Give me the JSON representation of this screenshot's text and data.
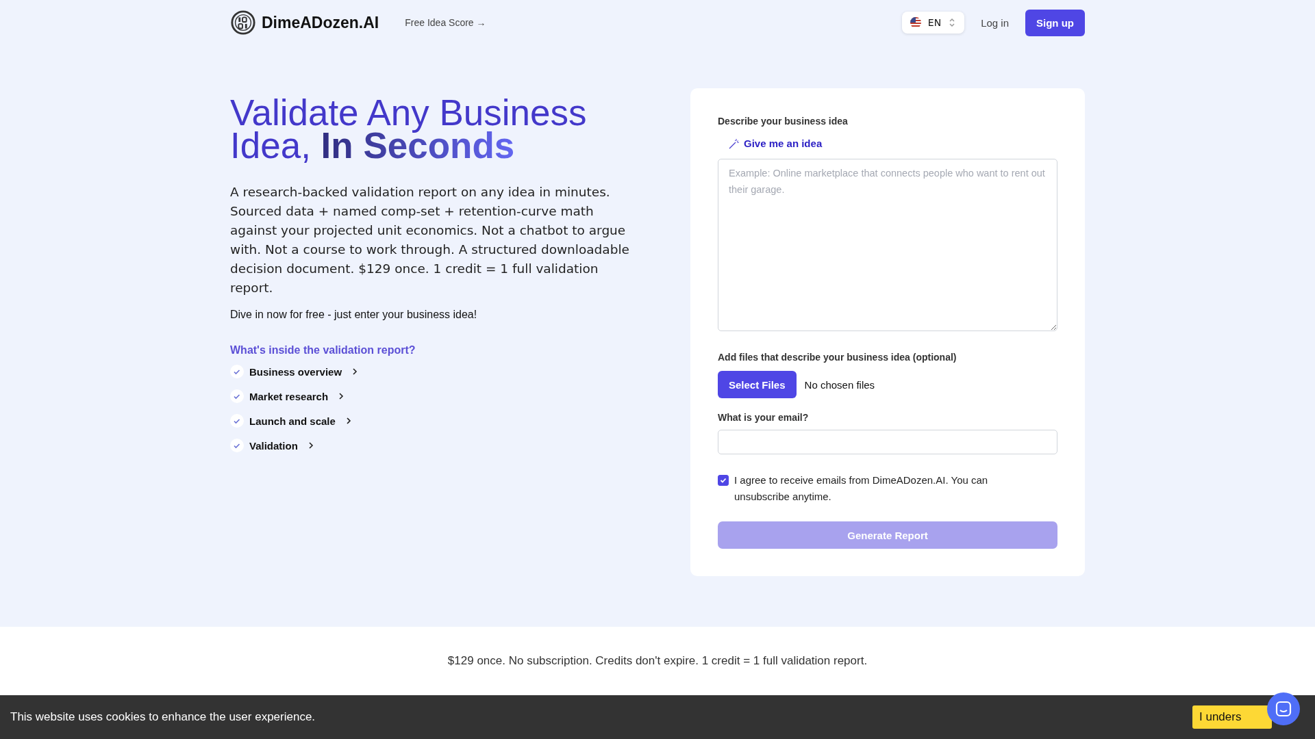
{
  "header": {
    "logo": "DimeADozen.AI",
    "nav_link": "Free Idea Score →",
    "language": "EN",
    "login": "Log in",
    "signup": "Sign up"
  },
  "hero": {
    "title_plain": "Validate Any Business Idea,",
    "title_bold": "In Seconds",
    "description": "A research-backed validation report on any idea in minutes. Sourced data + named comp-set + retention-curve math against your projected unit economics. Not a chatbot to argue with. Not a course to work through. A structured downloadable decision document. $129 once. 1 credit = 1 full validation report.",
    "subtitle": "Dive in now for free - just enter your business idea!",
    "report_heading": "What's inside the validation report?",
    "report_items": [
      {
        "label": "Business overview"
      },
      {
        "label": "Market research"
      },
      {
        "label": "Launch and scale"
      },
      {
        "label": "Validation"
      }
    ]
  },
  "form": {
    "idea_label": "Describe your business idea",
    "idea_link": "Give me an idea",
    "idea_placeholder": "Example: Online marketplace that connects people who want to rent out their garage.",
    "files_label": "Add files that describe your business idea (optional)",
    "files_button": "Select Files",
    "files_status": "No chosen files",
    "email_label": "What is your email?",
    "consent": "I agree to receive emails from DimeADozen.AI. You can unsubscribe anytime.",
    "consent_checked": true,
    "submit": "Generate Report",
    "submit_disabled": true
  },
  "pricing_note": "$129 once. No subscription. Credits don't expire. 1 credit = 1 full validation report.",
  "cookie_bar": {
    "message": "This website uses cookies to enhance the user experience.",
    "button": "I unders"
  }
}
